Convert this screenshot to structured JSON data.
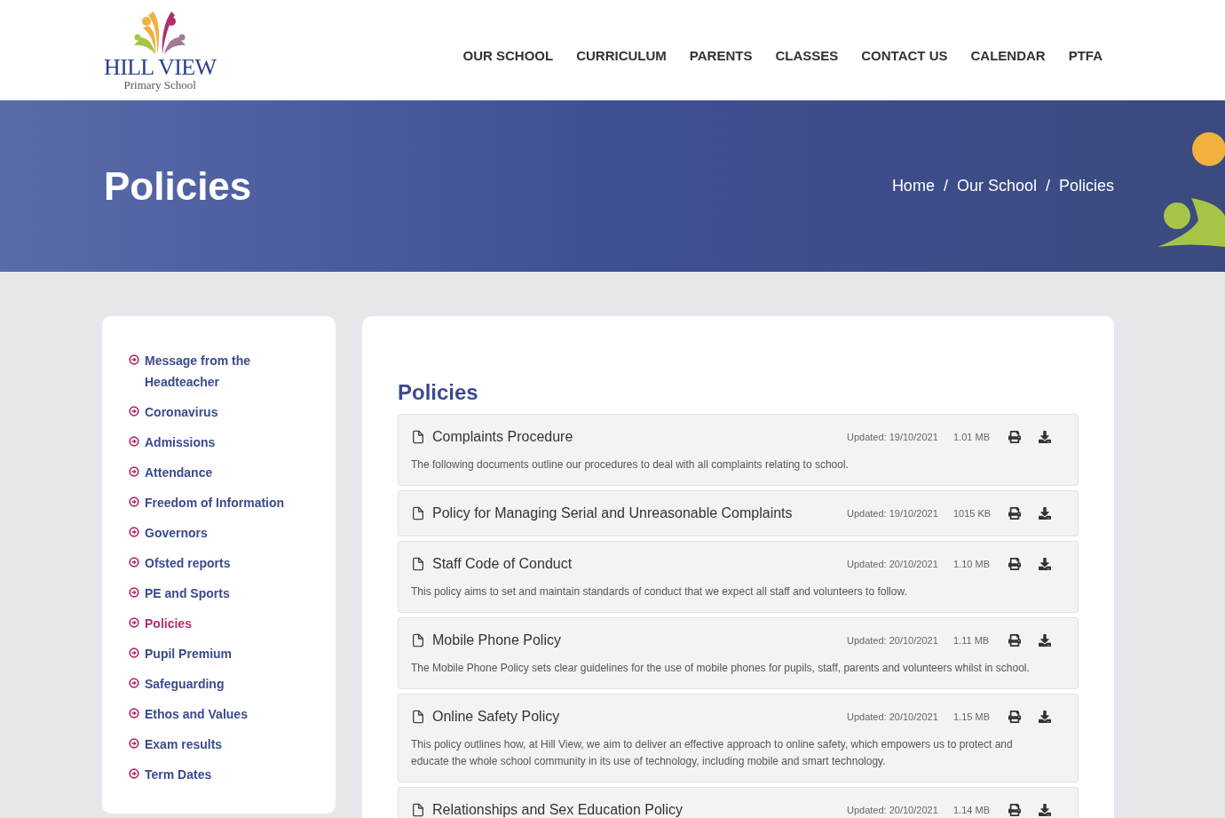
{
  "logo": {
    "name": "HILL VIEW",
    "subtitle": "Primary School"
  },
  "nav": [
    "OUR SCHOOL",
    "CURRICULUM",
    "PARENTS",
    "CLASSES",
    "CONTACT US",
    "CALENDAR",
    "PTFA"
  ],
  "banner": {
    "title": "Policies",
    "breadcrumb": [
      "Home",
      "Our School",
      "Policies"
    ],
    "separator": "/"
  },
  "sidebar": {
    "items": [
      {
        "label": "Message from the Headteacher",
        "selected": false
      },
      {
        "label": "Coronavirus",
        "selected": false
      },
      {
        "label": "Admissions",
        "selected": false
      },
      {
        "label": "Attendance",
        "selected": false
      },
      {
        "label": "Freedom of Information",
        "selected": false
      },
      {
        "label": "Governors",
        "selected": false
      },
      {
        "label": "Ofsted reports",
        "selected": false
      },
      {
        "label": "PE and Sports",
        "selected": false
      },
      {
        "label": "Policies",
        "selected": true
      },
      {
        "label": "Pupil Premium",
        "selected": false
      },
      {
        "label": "Safeguarding",
        "selected": false
      },
      {
        "label": "Ethos and Values",
        "selected": false
      },
      {
        "label": "Exam results",
        "selected": false
      },
      {
        "label": "Term Dates",
        "selected": false
      }
    ]
  },
  "main": {
    "heading": "Policies",
    "documents": [
      {
        "title": "Complaints Procedure",
        "updated": "Updated: 19/10/2021",
        "size": "1.01 MB",
        "description": "The following documents outline our procedures to deal with all complaints relating to school."
      },
      {
        "title": "Policy for Managing Serial and Unreasonable Complaints",
        "updated": "Updated: 19/10/2021",
        "size": "1015 KB"
      },
      {
        "title": "Staff Code of Conduct",
        "updated": "Updated: 20/10/2021",
        "size": "1.10 MB",
        "description": "This policy aims to set and maintain standards of conduct that we expect all staff and volunteers to follow."
      },
      {
        "title": "Mobile Phone Policy",
        "updated": "Updated: 20/10/2021",
        "size": "1.11 MB",
        "description": "The Mobile Phone Policy sets clear guidelines for the use of mobile phones for pupils, staff, parents and volunteers whilst in school."
      },
      {
        "title": "Online Safety Policy",
        "updated": "Updated: 20/10/2021",
        "size": "1.15 MB",
        "description": "This policy outlines how, at Hill View, we aim to deliver an effective approach to online safety, which empowers us to protect and educate the whole school community in its use of technology, including mobile and smart technology."
      },
      {
        "title": "Relationships and Sex Education Policy",
        "updated": "Updated: 20/10/2021",
        "size": "1.14 MB"
      }
    ]
  }
}
